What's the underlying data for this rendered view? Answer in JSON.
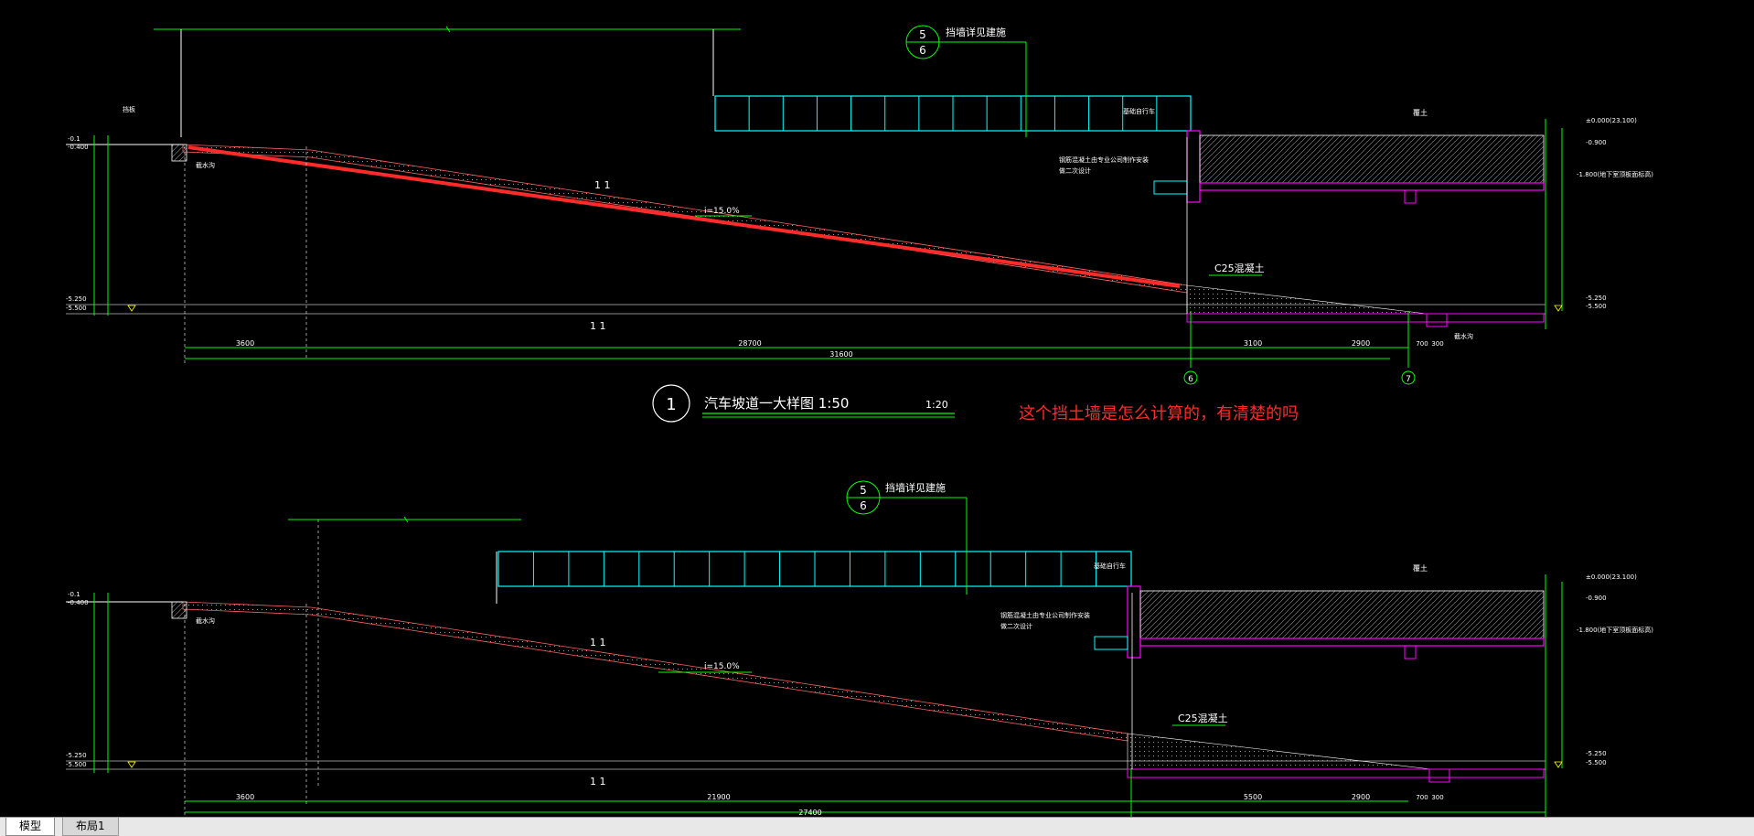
{
  "colors": {
    "background": "#000000",
    "green": "#00ff00",
    "cyan": "#00ffff",
    "magenta": "#ff00ff",
    "yellow": "#ffff00",
    "white": "#ffffff",
    "red": "#ff2a2a",
    "dim": "#b0b0b0"
  },
  "icons": {
    "section_marker": "circle-divided",
    "elevation_mark": "triangle-down"
  },
  "drawing1": {
    "section_top": "5",
    "section_bottom": "6",
    "retaining_note": "挡墙详见建施",
    "slope": "i=15.0%",
    "concrete": "C25混凝土",
    "section_mark": "1 1",
    "dims": [
      "3600",
      "28700",
      "3100",
      "2900",
      "700",
      "300"
    ],
    "total_dim": "31600",
    "axis_a": "6",
    "axis_b": "7",
    "el_left_top": "-0.1",
    "el_left_2": "-0.400",
    "el_left_bottom": "-5.250",
    "el_left_bottom2": "-5.500",
    "el_right_top": "±0.000(23.100)",
    "el_right_2": "-0.900",
    "el_right_3": "-1.800(地下室顶板面标高)",
    "el_right_bottom": "-5.250",
    "el_right_bottom2": "-5.500",
    "lbl_soil": "覆土",
    "lbl_drain": "截水沟",
    "lbl_dz": "挡板",
    "lbl_wall": "基础自行车",
    "lbl_design": "钢筋混凝土由专业公司制作安装",
    "lbl_design2": "做二次设计",
    "lbl_curb": "截水沟"
  },
  "title": {
    "number": "1",
    "text": "汽车坡道一大样图 1:50",
    "scale": "1:20"
  },
  "question": "这个挡土墙是怎么计算的，有清楚的吗",
  "drawing2": {
    "section_top": "5",
    "section_bottom": "6",
    "retaining_note": "挡墙详见建施",
    "slope": "i=15.0%",
    "concrete": "C25混凝土",
    "section_mark": "1 1",
    "dims": [
      "3600",
      "21900",
      "5500",
      "2900",
      "700",
      "300"
    ],
    "total_dim": "27400",
    "el_left_top": "-0.1",
    "el_left_2": "-0.400",
    "el_left_bottom": "-5.250",
    "el_left_bottom2": "-5.500",
    "el_right_top": "±0.000(23.100)",
    "el_right_2": "-0.900",
    "el_right_3": "-1.800(地下室顶板面标高)",
    "el_right_bottom": "-5.250",
    "el_right_bottom2": "-5.500",
    "lbl_soil": "覆土",
    "lbl_drain": "截水沟",
    "lbl_wall": "基础自行车",
    "lbl_design": "钢筋混凝土由专业公司制作安装",
    "lbl_design2": "做二次设计"
  },
  "tabs": [
    "模型",
    "布局1"
  ]
}
